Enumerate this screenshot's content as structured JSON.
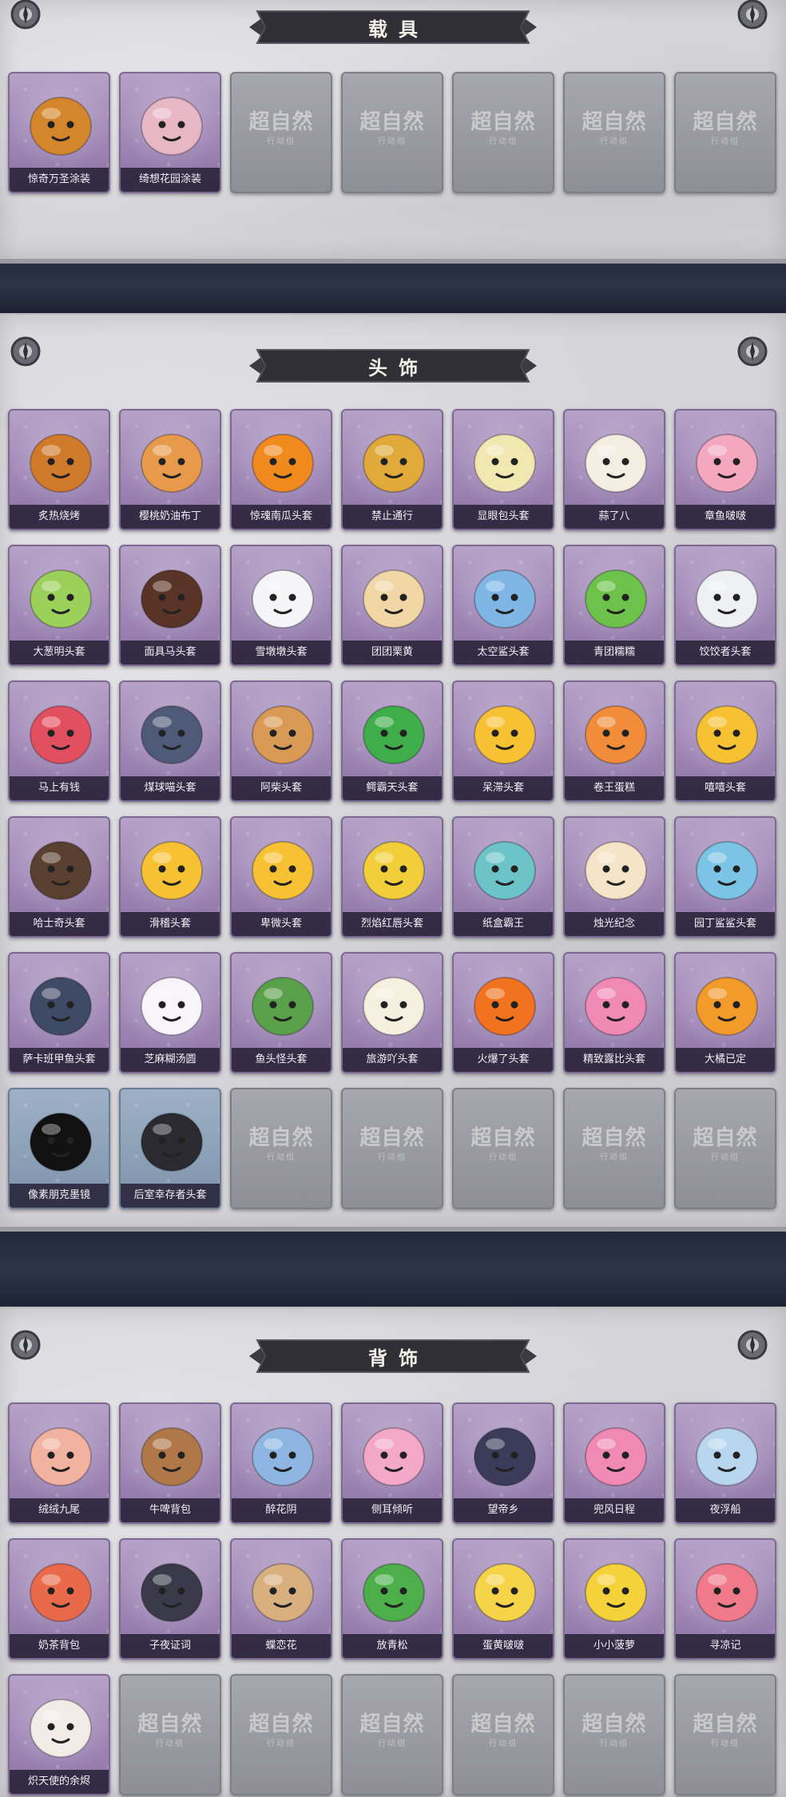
{
  "empty_slot": {
    "watermark": "超自然",
    "watermark_sub": "行动组"
  },
  "sections": {
    "vehicles": {
      "title": "载具",
      "items": [
        {
          "label": "惊奇万圣涂装",
          "icon": "truck-icon",
          "color": "#d4862c"
        },
        {
          "label": "绮想花园涂装",
          "icon": "food-truck-icon",
          "color": "#e8b7c6"
        }
      ],
      "empty_count": 5
    },
    "headwear": {
      "title": "头饰",
      "items": [
        {
          "label": "炙热烧烤",
          "icon": "toast-icon",
          "color": "#d07a2b"
        },
        {
          "label": "樱桃奶油布丁",
          "icon": "pudding-icon",
          "color": "#e79a4a"
        },
        {
          "label": "惊魂南瓜头套",
          "icon": "pumpkin-icon",
          "color": "#f08a1f"
        },
        {
          "label": "禁止通行",
          "icon": "traffic-cone-icon",
          "color": "#e0a93a"
        },
        {
          "label": "显眼包头套",
          "icon": "bulb-head-icon",
          "color": "#f1e7b0"
        },
        {
          "label": "蒜了八",
          "icon": "garlic-icon",
          "color": "#f2eee2"
        },
        {
          "label": "章鱼啵啵",
          "icon": "octopus-icon",
          "color": "#f3a8c0"
        },
        {
          "label": "大葱明头套",
          "icon": "scallion-icon",
          "color": "#9bd05a"
        },
        {
          "label": "面具马头套",
          "icon": "horse-mask-icon",
          "color": "#5a3426"
        },
        {
          "label": "雪墩墩头套",
          "icon": "snowman-icon",
          "color": "#f5f5f7"
        },
        {
          "label": "团团栗黄",
          "icon": "chestnut-icon",
          "color": "#f2d7a6"
        },
        {
          "label": "太空鲨头套",
          "icon": "space-shark-icon",
          "color": "#7fb6e6"
        },
        {
          "label": "青团糯糯",
          "icon": "qingtuan-icon",
          "color": "#6cc24a"
        },
        {
          "label": "饺饺者头套",
          "icon": "dumpling-icon",
          "color": "#eef0f4"
        },
        {
          "label": "马上有钱",
          "icon": "horse-icon",
          "color": "#e25060"
        },
        {
          "label": "煤球喵头套",
          "icon": "black-cat-icon",
          "color": "#4f5a78"
        },
        {
          "label": "阿柴头套",
          "icon": "shiba-icon",
          "color": "#d99a55"
        },
        {
          "label": "鳄霸天头套",
          "icon": "crocodile-icon",
          "color": "#3fae4a"
        },
        {
          "label": "呆滞头套",
          "icon": "dazed-face-icon",
          "color": "#f6c233"
        },
        {
          "label": "卷王蛋糕",
          "icon": "cake-roll-icon",
          "color": "#f08c3a"
        },
        {
          "label": "嘻嘻头套",
          "icon": "grin-face-icon",
          "color": "#f6c233"
        },
        {
          "label": "哈士奇头套",
          "icon": "husky-icon",
          "color": "#5a4030"
        },
        {
          "label": "滑稽头套",
          "icon": "smirk-face-icon",
          "color": "#f6c233"
        },
        {
          "label": "卑微头套",
          "icon": "humble-face-icon",
          "color": "#f6c233"
        },
        {
          "label": "烈焰红唇头套",
          "icon": "pikachu-icon",
          "color": "#f2cf3a"
        },
        {
          "label": "纸盒霸王",
          "icon": "box-dino-icon",
          "color": "#6cc3c8"
        },
        {
          "label": "烛光纪念",
          "icon": "candle-icon",
          "color": "#f5e4c8"
        },
        {
          "label": "园丁鲨鲨头套",
          "icon": "shark-icon",
          "color": "#7cc4e6"
        },
        {
          "label": "萨卡班甲鱼头套",
          "icon": "fish-icon",
          "color": "#3e4a66"
        },
        {
          "label": "芝麻糊汤圆",
          "icon": "tangyuan-icon",
          "color": "#f7f5fa"
        },
        {
          "label": "鱼头怪头套",
          "icon": "fish-head-icon",
          "color": "#5aa04a"
        },
        {
          "label": "旅游吖头套",
          "icon": "duck-hat-icon",
          "color": "#f5f0e0"
        },
        {
          "label": "火爆了头套",
          "icon": "fire-icon",
          "color": "#f2731f"
        },
        {
          "label": "精致露比头套",
          "icon": "loopy-icon",
          "color": "#f08ab5"
        },
        {
          "label": "大橘已定",
          "icon": "orange-icon",
          "color": "#f29a2a"
        },
        {
          "label": "像素朋克墨镜",
          "icon": "pixel-glasses-icon",
          "color": "#111111",
          "variant": "blue"
        },
        {
          "label": "后室幸存者头套",
          "icon": "gas-mask-icon",
          "color": "#2a2a30",
          "variant": "blue"
        }
      ],
      "empty_count": 5
    },
    "back": {
      "title": "背饰",
      "items": [
        {
          "label": "绒绒九尾",
          "icon": "fox-icon",
          "color": "#f1b2a0"
        },
        {
          "label": "牛啤背包",
          "icon": "barrel-icon",
          "color": "#b07848"
        },
        {
          "label": "醉花阴",
          "icon": "flower-wreath-icon",
          "color": "#8fb6e2"
        },
        {
          "label": "侧耳倾听",
          "icon": "lotus-icon",
          "color": "#f2a8c6"
        },
        {
          "label": "望帝乡",
          "icon": "figure-icon",
          "color": "#3b3b5a"
        },
        {
          "label": "兜风日程",
          "icon": "loopy-cap-icon",
          "color": "#f08ab5"
        },
        {
          "label": "夜浮船",
          "icon": "jellyfish-icon",
          "color": "#b8d6ee"
        },
        {
          "label": "奶茶背包",
          "icon": "milk-tea-icon",
          "color": "#e86a4a"
        },
        {
          "label": "子夜证词",
          "icon": "raven-icon",
          "color": "#3a3a4a"
        },
        {
          "label": "蝶恋花",
          "icon": "bell-icon",
          "color": "#d8b080"
        },
        {
          "label": "放青松",
          "icon": "bonsai-icon",
          "color": "#4caf4a"
        },
        {
          "label": "蛋黄啵啵",
          "icon": "chick-icon",
          "color": "#f6d44a"
        },
        {
          "label": "小小菠萝",
          "icon": "pineapple-icon",
          "color": "#f4d23a"
        },
        {
          "label": "寻凉记",
          "icon": "pink-bear-icon",
          "color": "#f07a8a"
        },
        {
          "label": "炽天使的余烬",
          "icon": "angel-icon",
          "color": "#f2ece6"
        }
      ],
      "empty_count": 6
    }
  }
}
